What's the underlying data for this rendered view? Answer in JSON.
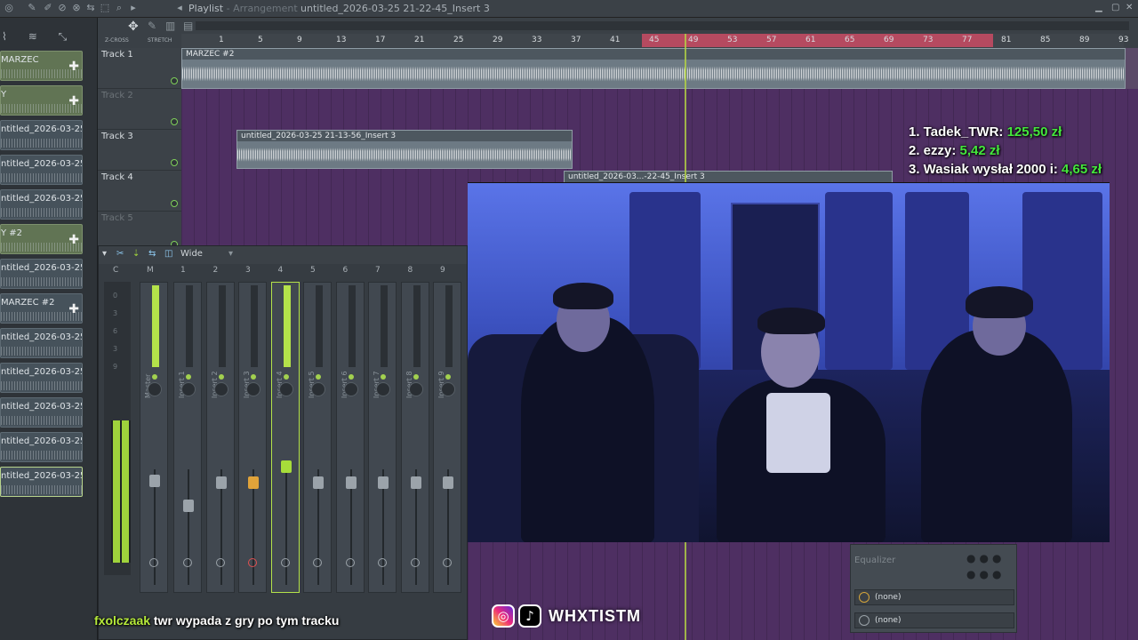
{
  "topbar": {
    "title": "Playlist",
    "title_sep": " - ",
    "title_sub": "Arrangement",
    "file": "untitled_2026-03-25 21-22-45_Insert 3"
  },
  "browser": {
    "items": [
      {
        "label": "MARZEC",
        "kind": "green"
      },
      {
        "label": "Y",
        "kind": "green"
      },
      {
        "label": "ntitled_2026-03-25 21-...",
        "kind": "clip"
      },
      {
        "label": "ntitled_2026-03-25 21-...",
        "kind": "clip"
      },
      {
        "label": "ntitled_2026-03-25 21-...",
        "kind": "clip"
      },
      {
        "label": "Y #2",
        "kind": "green"
      },
      {
        "label": "ntitled_2026-03-25 21-...",
        "kind": "clip"
      },
      {
        "label": "MARZEC #2",
        "kind": "clip"
      },
      {
        "label": "ntitled_2026-03-25 21-...",
        "kind": "clip"
      },
      {
        "label": "ntitled_2026-03-25 21-...",
        "kind": "clip"
      },
      {
        "label": "ntitled_2026-03-25 21-...",
        "kind": "clip"
      },
      {
        "label": "ntitled_2026-03-25 21-...",
        "kind": "clip"
      },
      {
        "label": "ntitled_2026-03-25 21-...",
        "kind": "clip"
      }
    ]
  },
  "toolbar": {
    "zcross": "Z-CROSS",
    "stretch": "STRETCH"
  },
  "ruler": {
    "marks": [
      "1",
      "5",
      "9",
      "13",
      "17",
      "21",
      "25",
      "29",
      "33",
      "37",
      "41",
      "45",
      "49",
      "53",
      "57",
      "61",
      "65",
      "69",
      "73",
      "77",
      "81",
      "85",
      "89",
      "93"
    ]
  },
  "tracks": [
    {
      "label": "Track 1"
    },
    {
      "label": "Track 2"
    },
    {
      "label": "Track 3"
    },
    {
      "label": "Track 4"
    },
    {
      "label": "Track 5"
    }
  ],
  "clips": {
    "marzec": "MARZEC #2",
    "insert3a": "untitled_2026-03-25 21-13-56_Insert 3",
    "insert3b": "untitled_2026-03...-22-45_Insert 3"
  },
  "mixer": {
    "preset": "Wide",
    "columns": [
      "C",
      "M",
      "1",
      "2",
      "3",
      "4",
      "5",
      "6",
      "7",
      "8",
      "9"
    ],
    "strips": [
      "Master",
      "Insert 1",
      "Insert 2",
      "Insert 3",
      "Insert 4",
      "Insert 5",
      "Insert 6",
      "Insert 7",
      "Insert 8",
      "Insert 9"
    ],
    "scale": [
      "0",
      "3",
      "6",
      "3",
      "9"
    ]
  },
  "donations": {
    "line1_label": "1. Tadek_TWR: ",
    "line1_amount": "125,50 zł",
    "line2_label": "2. ezzy: ",
    "line2_amount": "5,42 zł",
    "line3_label": "3. Wasiak wysłał 2000 i: ",
    "line3_amount": "4,65 zł"
  },
  "fx": {
    "plugin": "Equalizer",
    "slot1": "(none)",
    "slot2": "(none)"
  },
  "chat": {
    "user": "fxolczaak",
    "message": " twr wypada z gry po tym tracku"
  },
  "social": {
    "handle": "WHXTISTM"
  },
  "colors": {
    "accent_green": "#9fd23c",
    "donation_amount": "#44e63c",
    "loop_region": "#b54a60",
    "playlist_bg": "#4e2f62"
  }
}
